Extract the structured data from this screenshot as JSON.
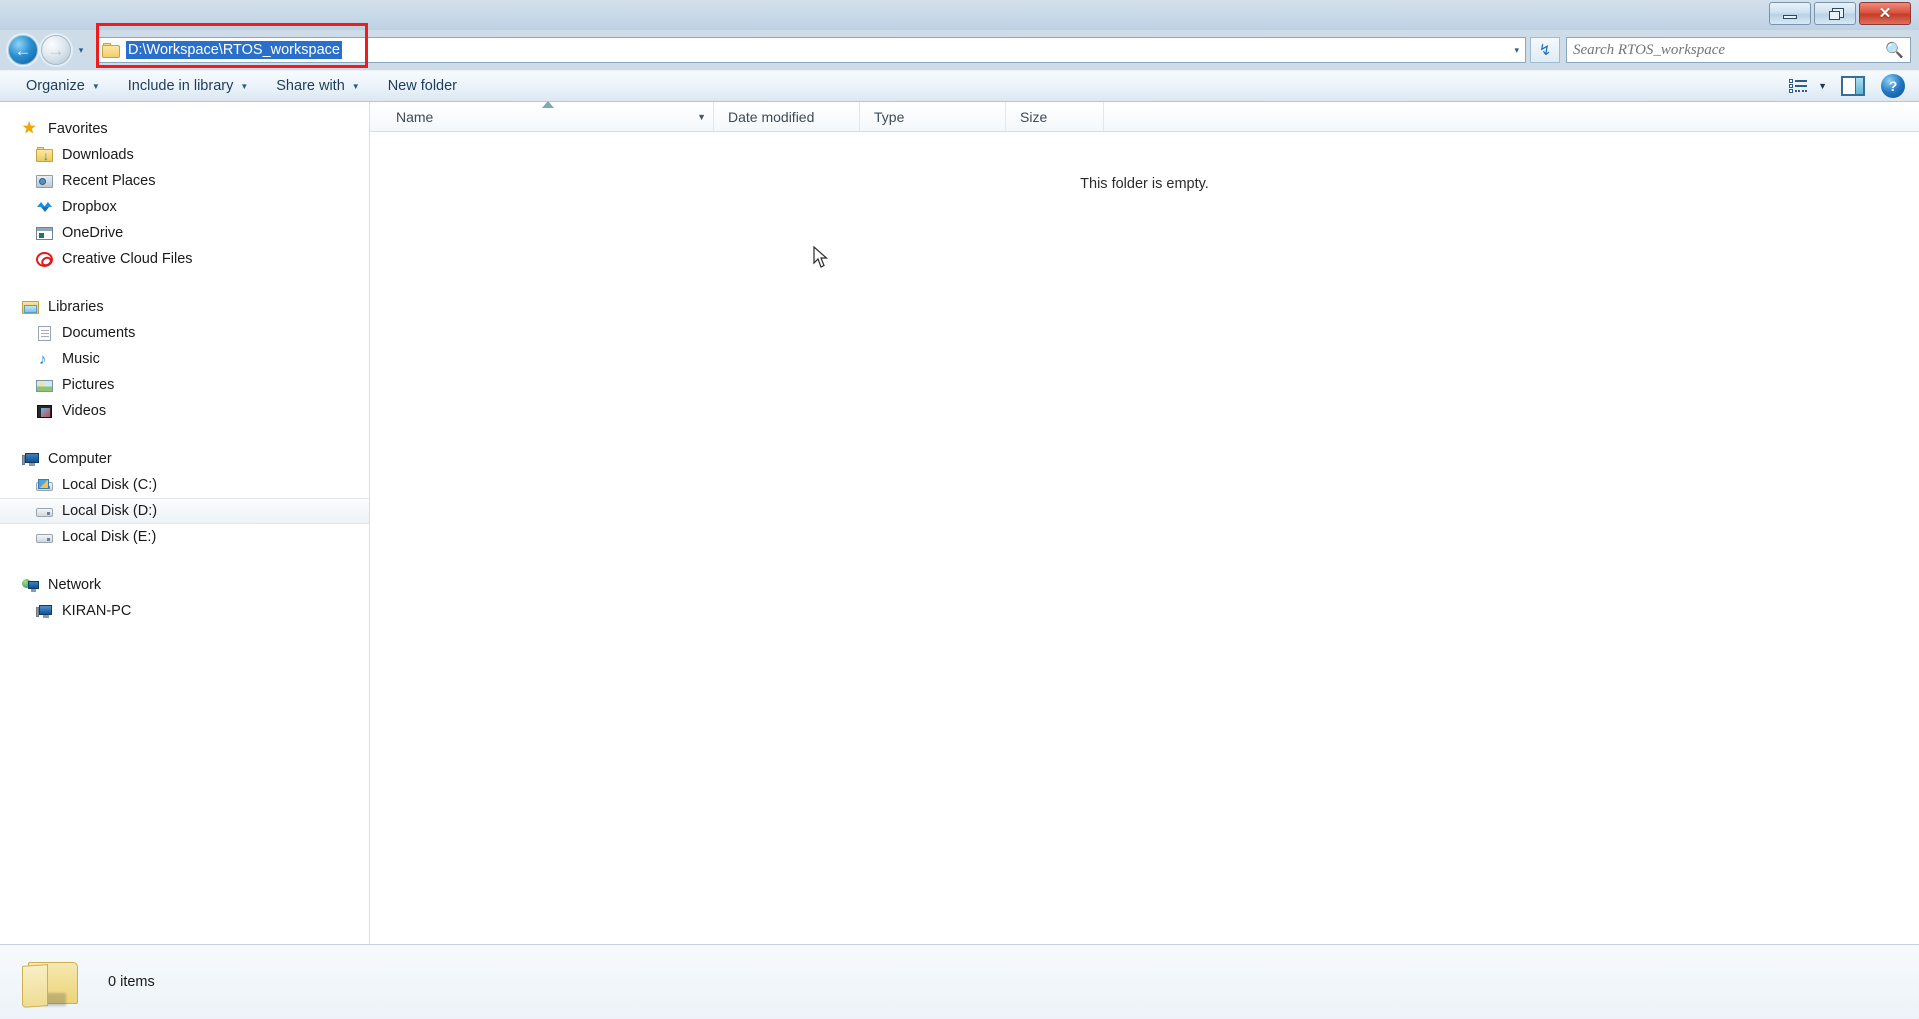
{
  "window": {
    "controls": {
      "minimize_label": "Minimize",
      "restore_label": "Restore",
      "close_label": "Close"
    }
  },
  "addressbar": {
    "back_label": "Back",
    "forward_label": "Forward",
    "history_caret": "▾",
    "path_text": "D:\\Workspace\\RTOS_workspace",
    "path_selected": true,
    "dropdown_caret": "▾",
    "refresh_icon": "↯",
    "annotation_color": "#ee1c1c"
  },
  "search": {
    "placeholder": "Search RTOS_workspace",
    "value": "",
    "icon": "search-icon"
  },
  "toolbar": {
    "buttons": [
      {
        "label": "Organize",
        "caret": "▼"
      },
      {
        "label": "Include in library",
        "caret": "▼"
      },
      {
        "label": "Share with",
        "caret": "▼"
      },
      {
        "label": "New folder",
        "caret": ""
      }
    ],
    "view_caret": "▼",
    "help_glyph": "?"
  },
  "sidebar": {
    "groups": [
      {
        "header": {
          "label": "Favorites",
          "icon": "star-icon"
        },
        "items": [
          {
            "label": "Downloads",
            "icon": "downloads-folder-icon"
          },
          {
            "label": "Recent Places",
            "icon": "recent-places-icon"
          },
          {
            "label": "Dropbox",
            "icon": "dropbox-icon"
          },
          {
            "label": "OneDrive",
            "icon": "onedrive-icon"
          },
          {
            "label": "Creative Cloud Files",
            "icon": "creative-cloud-icon"
          }
        ]
      },
      {
        "header": {
          "label": "Libraries",
          "icon": "libraries-icon"
        },
        "items": [
          {
            "label": "Documents",
            "icon": "document-icon"
          },
          {
            "label": "Music",
            "icon": "music-note-icon"
          },
          {
            "label": "Pictures",
            "icon": "picture-icon"
          },
          {
            "label": "Videos",
            "icon": "video-icon"
          }
        ]
      },
      {
        "header": {
          "label": "Computer",
          "icon": "computer-icon"
        },
        "items": [
          {
            "label": "Local Disk (C:)",
            "icon": "windows-drive-icon",
            "selected": false
          },
          {
            "label": "Local Disk (D:)",
            "icon": "drive-icon",
            "selected": true
          },
          {
            "label": "Local Disk (E:)",
            "icon": "drive-icon",
            "selected": false
          }
        ]
      },
      {
        "header": {
          "label": "Network",
          "icon": "network-icon"
        },
        "items": [
          {
            "label": "KIRAN-PC",
            "icon": "network-computer-icon"
          }
        ]
      }
    ]
  },
  "filelist": {
    "columns": [
      {
        "label": "Name",
        "caret": "▼",
        "sorted": "ascending"
      },
      {
        "label": "Date modified",
        "caret": ""
      },
      {
        "label": "Type",
        "caret": ""
      },
      {
        "label": "Size",
        "caret": ""
      }
    ],
    "empty_message": "This folder is empty.",
    "rows": []
  },
  "statusbar": {
    "item_count_text": "0 items",
    "folder_icon": "folder-icon"
  }
}
